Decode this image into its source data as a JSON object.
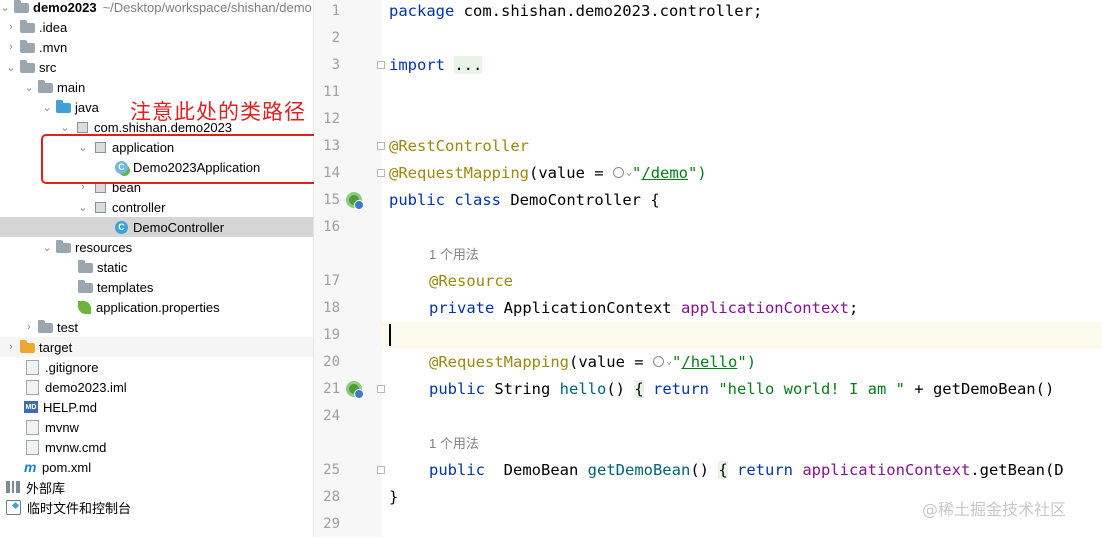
{
  "tree": {
    "project_name": "demo2023",
    "project_path": "~/Desktop/workspace/shishan/demo",
    "items": [
      {
        "label": ".idea"
      },
      {
        "label": ".mvn"
      },
      {
        "label": "src"
      },
      {
        "label": "main"
      },
      {
        "label": "java"
      },
      {
        "label": "com.shishan.demo2023"
      },
      {
        "label": "application"
      },
      {
        "label": "Demo2023Application"
      },
      {
        "label": "bean"
      },
      {
        "label": "controller"
      },
      {
        "label": "DemoController"
      },
      {
        "label": "resources"
      },
      {
        "label": "static"
      },
      {
        "label": "templates"
      },
      {
        "label": "application.properties"
      },
      {
        "label": "test"
      },
      {
        "label": "target"
      },
      {
        "label": ".gitignore"
      },
      {
        "label": "demo2023.iml"
      },
      {
        "label": "HELP.md"
      },
      {
        "label": "mvnw"
      },
      {
        "label": "mvnw.cmd"
      },
      {
        "label": "pom.xml"
      },
      {
        "label": "外部库"
      },
      {
        "label": "临时文件和控制台"
      }
    ],
    "annotation": "注意此处的类路径",
    "md_badge": "MD",
    "maven_glyph": "m",
    "class_glyph": "C"
  },
  "editor": {
    "line_numbers": [
      "1",
      "2",
      "3",
      "11",
      "12",
      "13",
      "14",
      "15",
      "16",
      "17",
      "18",
      "19",
      "20",
      "21",
      "24",
      "25",
      "28",
      "29"
    ],
    "usage_hint": "1 个用法",
    "code": {
      "l1_kw": "package",
      "l1_rest": " com.shishan.demo2023.controller;",
      "l3_kw": "import",
      "l3_fold": "...",
      "l13": "@RestController",
      "l14_ann": "@RequestMapping",
      "l14_a": "(value = ",
      "l14_str_q": "\"",
      "l14_link": "/demo",
      "l14_end": "\")",
      "l15_kw1": "public",
      "l15_kw2": "class",
      "l15_rest": " DemoController {",
      "l17": "@Resource",
      "l18_kw": "private",
      "l18_type": " ApplicationContext ",
      "l18_field": "applicationContext",
      "l18_end": ";",
      "l20_ann": "@RequestMapping",
      "l20_a": "(value = ",
      "l20_str_q": "\"",
      "l20_link": "/hello",
      "l20_end": "\")",
      "l21_kw": "public",
      "l21_type": " String ",
      "l21_fn": "hello",
      "l21_paren": "() ",
      "l21_brace": "{",
      "l21_ret": " return ",
      "l21_str": "\"hello world! I am \"",
      "l21_rest": " + getDemoBean()",
      "l25_kw": "public",
      "l25_type": "  DemoBean ",
      "l25_fn": "getDemoBean",
      "l25_paren": "() ",
      "l25_brace": "{",
      "l25_ret": " return ",
      "l25_field": "applicationContext",
      "l25_rest": ".getBean(D",
      "l28": "}"
    }
  },
  "watermark": "@稀土掘金技术社区"
}
